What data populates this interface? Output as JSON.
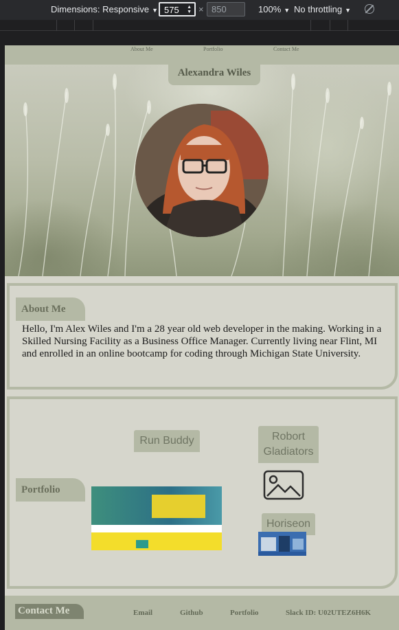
{
  "devtools": {
    "dimensions_label": "Dimensions: Responsive",
    "width": "575",
    "height": "850",
    "zoom": "100%",
    "throttling": "No throttling"
  },
  "site": {
    "nav": [
      "About Me",
      "Portfolio",
      "Contact Me"
    ],
    "name": "Alexandra Wiles",
    "about": {
      "title": "About Me",
      "text": "Hello, I'm Alex Wiles and I'm a 28 year old web developer in the making. Working in a Skilled Nursing Facility as a Business Office Manager. Currently living near Flint, MI and enrolled in an online bootcamp for coding through Michigan State University."
    },
    "portfolio": {
      "title": "Portfolio",
      "projects": [
        "Run Buddy",
        "Robort Gladiators",
        "Horiseon"
      ]
    },
    "contact": {
      "title": "Contact Me",
      "links": [
        "Email",
        "Github",
        "Portfolio",
        "Slack ID: U02UTEZ6H6K"
      ]
    },
    "colors": {
      "sage": "#b4b9a5",
      "background": "#d6d6cc",
      "text": "#1b1b1b"
    }
  }
}
